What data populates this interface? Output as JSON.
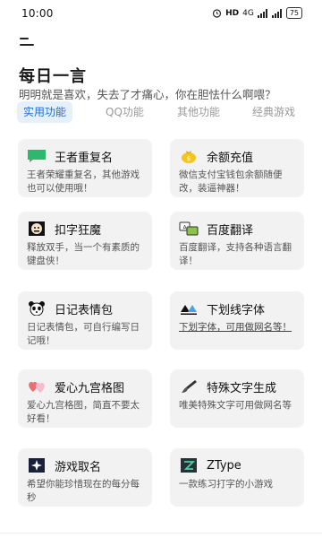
{
  "status_bar": {
    "time": "10:00",
    "network": "HD",
    "signal": "4G",
    "battery": "75"
  },
  "header": {
    "title": "每日一言",
    "quote": "明明就是喜欢，失去了才痛心，你在胆怯什么啊喂？"
  },
  "tabs": [
    {
      "label": "实用功能",
      "active": true
    },
    {
      "label": "QQ功能",
      "active": false
    },
    {
      "label": "其他功能",
      "active": false
    },
    {
      "label": "经典游戏",
      "active": false
    }
  ],
  "cards": [
    {
      "title": "王者重复名",
      "desc": "王者荣耀重复名，其他游戏也可以使用哦！",
      "icon": "flag-icon"
    },
    {
      "title": "余额充值",
      "desc": "微信支付宝钱包余额随便改，装逼神器！",
      "icon": "money-bag-icon"
    },
    {
      "title": "扣字狂魔",
      "desc": "释放双手，当一个有素质的键盘侠！",
      "icon": "keyboard-face-icon"
    },
    {
      "title": "百度翻译",
      "desc": "百度翻译，支持各种语言翻译！",
      "icon": "translate-icon"
    },
    {
      "title": "日记表情包",
      "desc": "日记表情包，可自行编写日记哦！",
      "icon": "panda-icon"
    },
    {
      "title": "下划线字体",
      "desc": "下划字体，可用做网名等！",
      "icon": "underline-icon"
    },
    {
      "title": "爱心九宫格图",
      "desc": "爱心九宫格图，简直不要太好看！",
      "icon": "heart-icon"
    },
    {
      "title": "特殊文字生成",
      "desc": "唯美特殊文字可用做网名等",
      "icon": "brush-icon"
    },
    {
      "title": "游戏取名",
      "desc": "希望你能珍惜现在的每分每秒",
      "icon": "star-icon"
    },
    {
      "title": "ZType",
      "desc": "一款练习打字的小游戏",
      "icon": "ztype-icon"
    }
  ],
  "colors": {
    "accent": "#1f6fd1",
    "tab_active_bg": "#e5f0fb",
    "card_bg": "#f2f2f2"
  }
}
